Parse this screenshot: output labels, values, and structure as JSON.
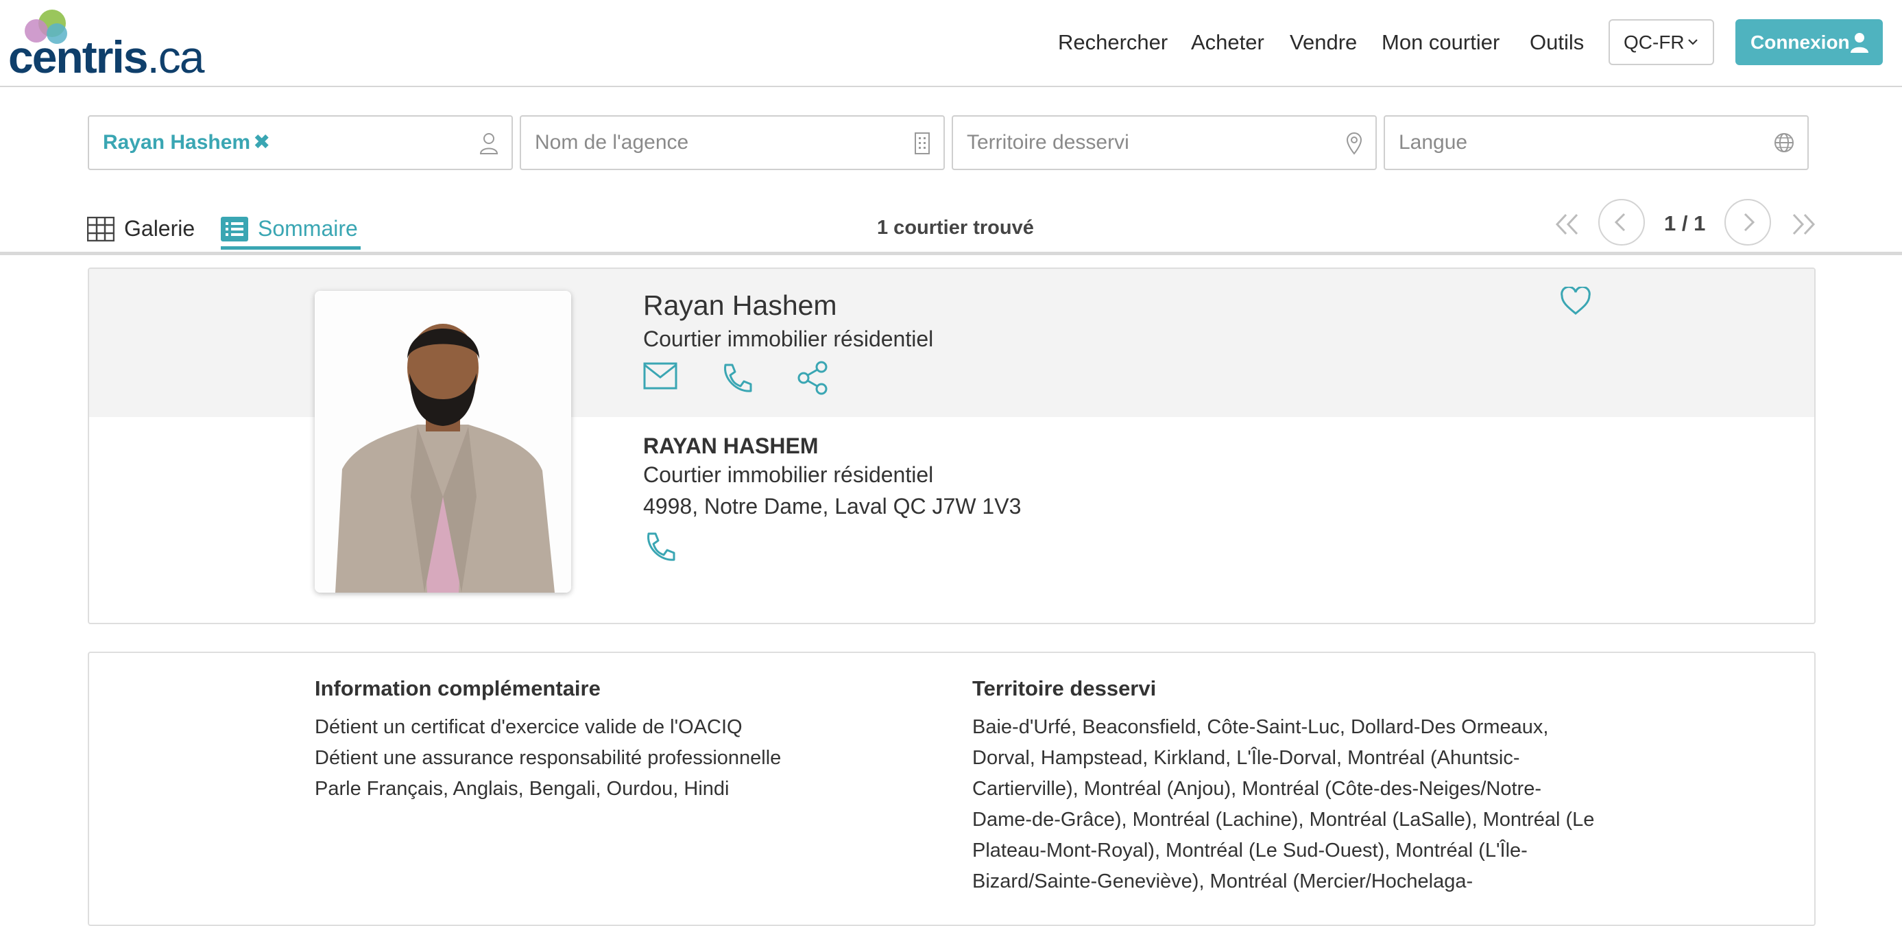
{
  "header": {
    "logo_bold": "centris",
    "logo_light": ".ca",
    "nav": [
      "Rechercher",
      "Acheter",
      "Vendre",
      "Mon courtier",
      "Outils"
    ],
    "language": "QC-FR",
    "login": "Connexion",
    "brand_color": "#4fb3bf"
  },
  "filters": {
    "broker_chip": "Rayan Hashem",
    "agency_placeholder": "Nom de l'agence",
    "territory_placeholder": "Territoire desservi",
    "language_placeholder": "Langue"
  },
  "view": {
    "tabs": [
      "Galerie",
      "Sommaire"
    ],
    "active_tab": "Sommaire",
    "result_count": "1 courtier trouvé",
    "pagination": "1 / 1"
  },
  "broker": {
    "name": "Rayan Hashem",
    "title": "Courtier immobilier résidentiel",
    "name_upper": "RAYAN HASHEM",
    "title2": "Courtier immobilier résidentiel",
    "address": "4998, Notre Dame, Laval QC J7W 1V3"
  },
  "info": {
    "heading": "Information complémentaire",
    "lines": [
      "Détient un certificat d'exercice valide de l'OACIQ",
      "Détient une assurance responsabilité professionnelle",
      "Parle Français, Anglais, Bengali, Ourdou, Hindi"
    ],
    "territory_heading": "Territoire desservi",
    "territory_text": "Baie-d'Urfé, Beaconsfield, Côte-Saint-Luc, Dollard-Des Ormeaux, Dorval, Hampstead, Kirkland, L'Île-Dorval, Montréal (Ahuntsic-Cartierville), Montréal (Anjou), Montréal (Côte-des-Neiges/Notre-Dame-de-Grâce), Montréal (Lachine), Montréal (LaSalle), Montréal (Le Plateau-Mont-Royal), Montréal (Le Sud-Ouest), Montréal (L'Île-Bizard/Sainte-Geneviève), Montréal (Mercier/Hochelaga-"
  }
}
